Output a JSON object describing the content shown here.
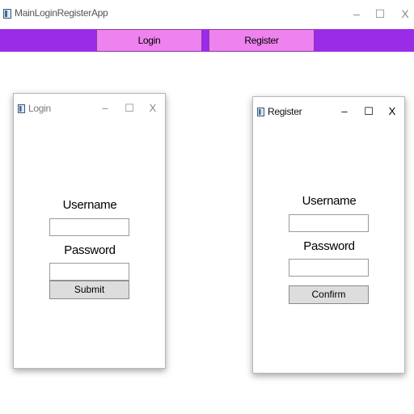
{
  "app": {
    "title": "MainLoginRegisterApp",
    "caption_minimize": "–",
    "caption_maximize": "☐",
    "caption_close": "X"
  },
  "nav": {
    "login_label": "Login",
    "register_label": "Register"
  },
  "login_window": {
    "title": "Login",
    "caption_minimize": "–",
    "caption_maximize": "☐",
    "caption_close": "X",
    "username_label": "Username",
    "username_value": "",
    "password_label": "Password",
    "password_value": "",
    "submit_label": "Submit"
  },
  "register_window": {
    "title": "Register",
    "caption_minimize": "–",
    "caption_maximize": "☐",
    "caption_close": "X",
    "username_label": "Username",
    "username_value": "",
    "password_label": "Password",
    "password_value": "",
    "confirm_label": "Confirm"
  },
  "colors": {
    "nav_bar": "#9a2ce8",
    "nav_button": "#ee82ee",
    "button_gray": "#dddddd"
  },
  "icons": {
    "app": "app-window-icon",
    "login_window": "window-icon",
    "register_window": "window-icon"
  }
}
